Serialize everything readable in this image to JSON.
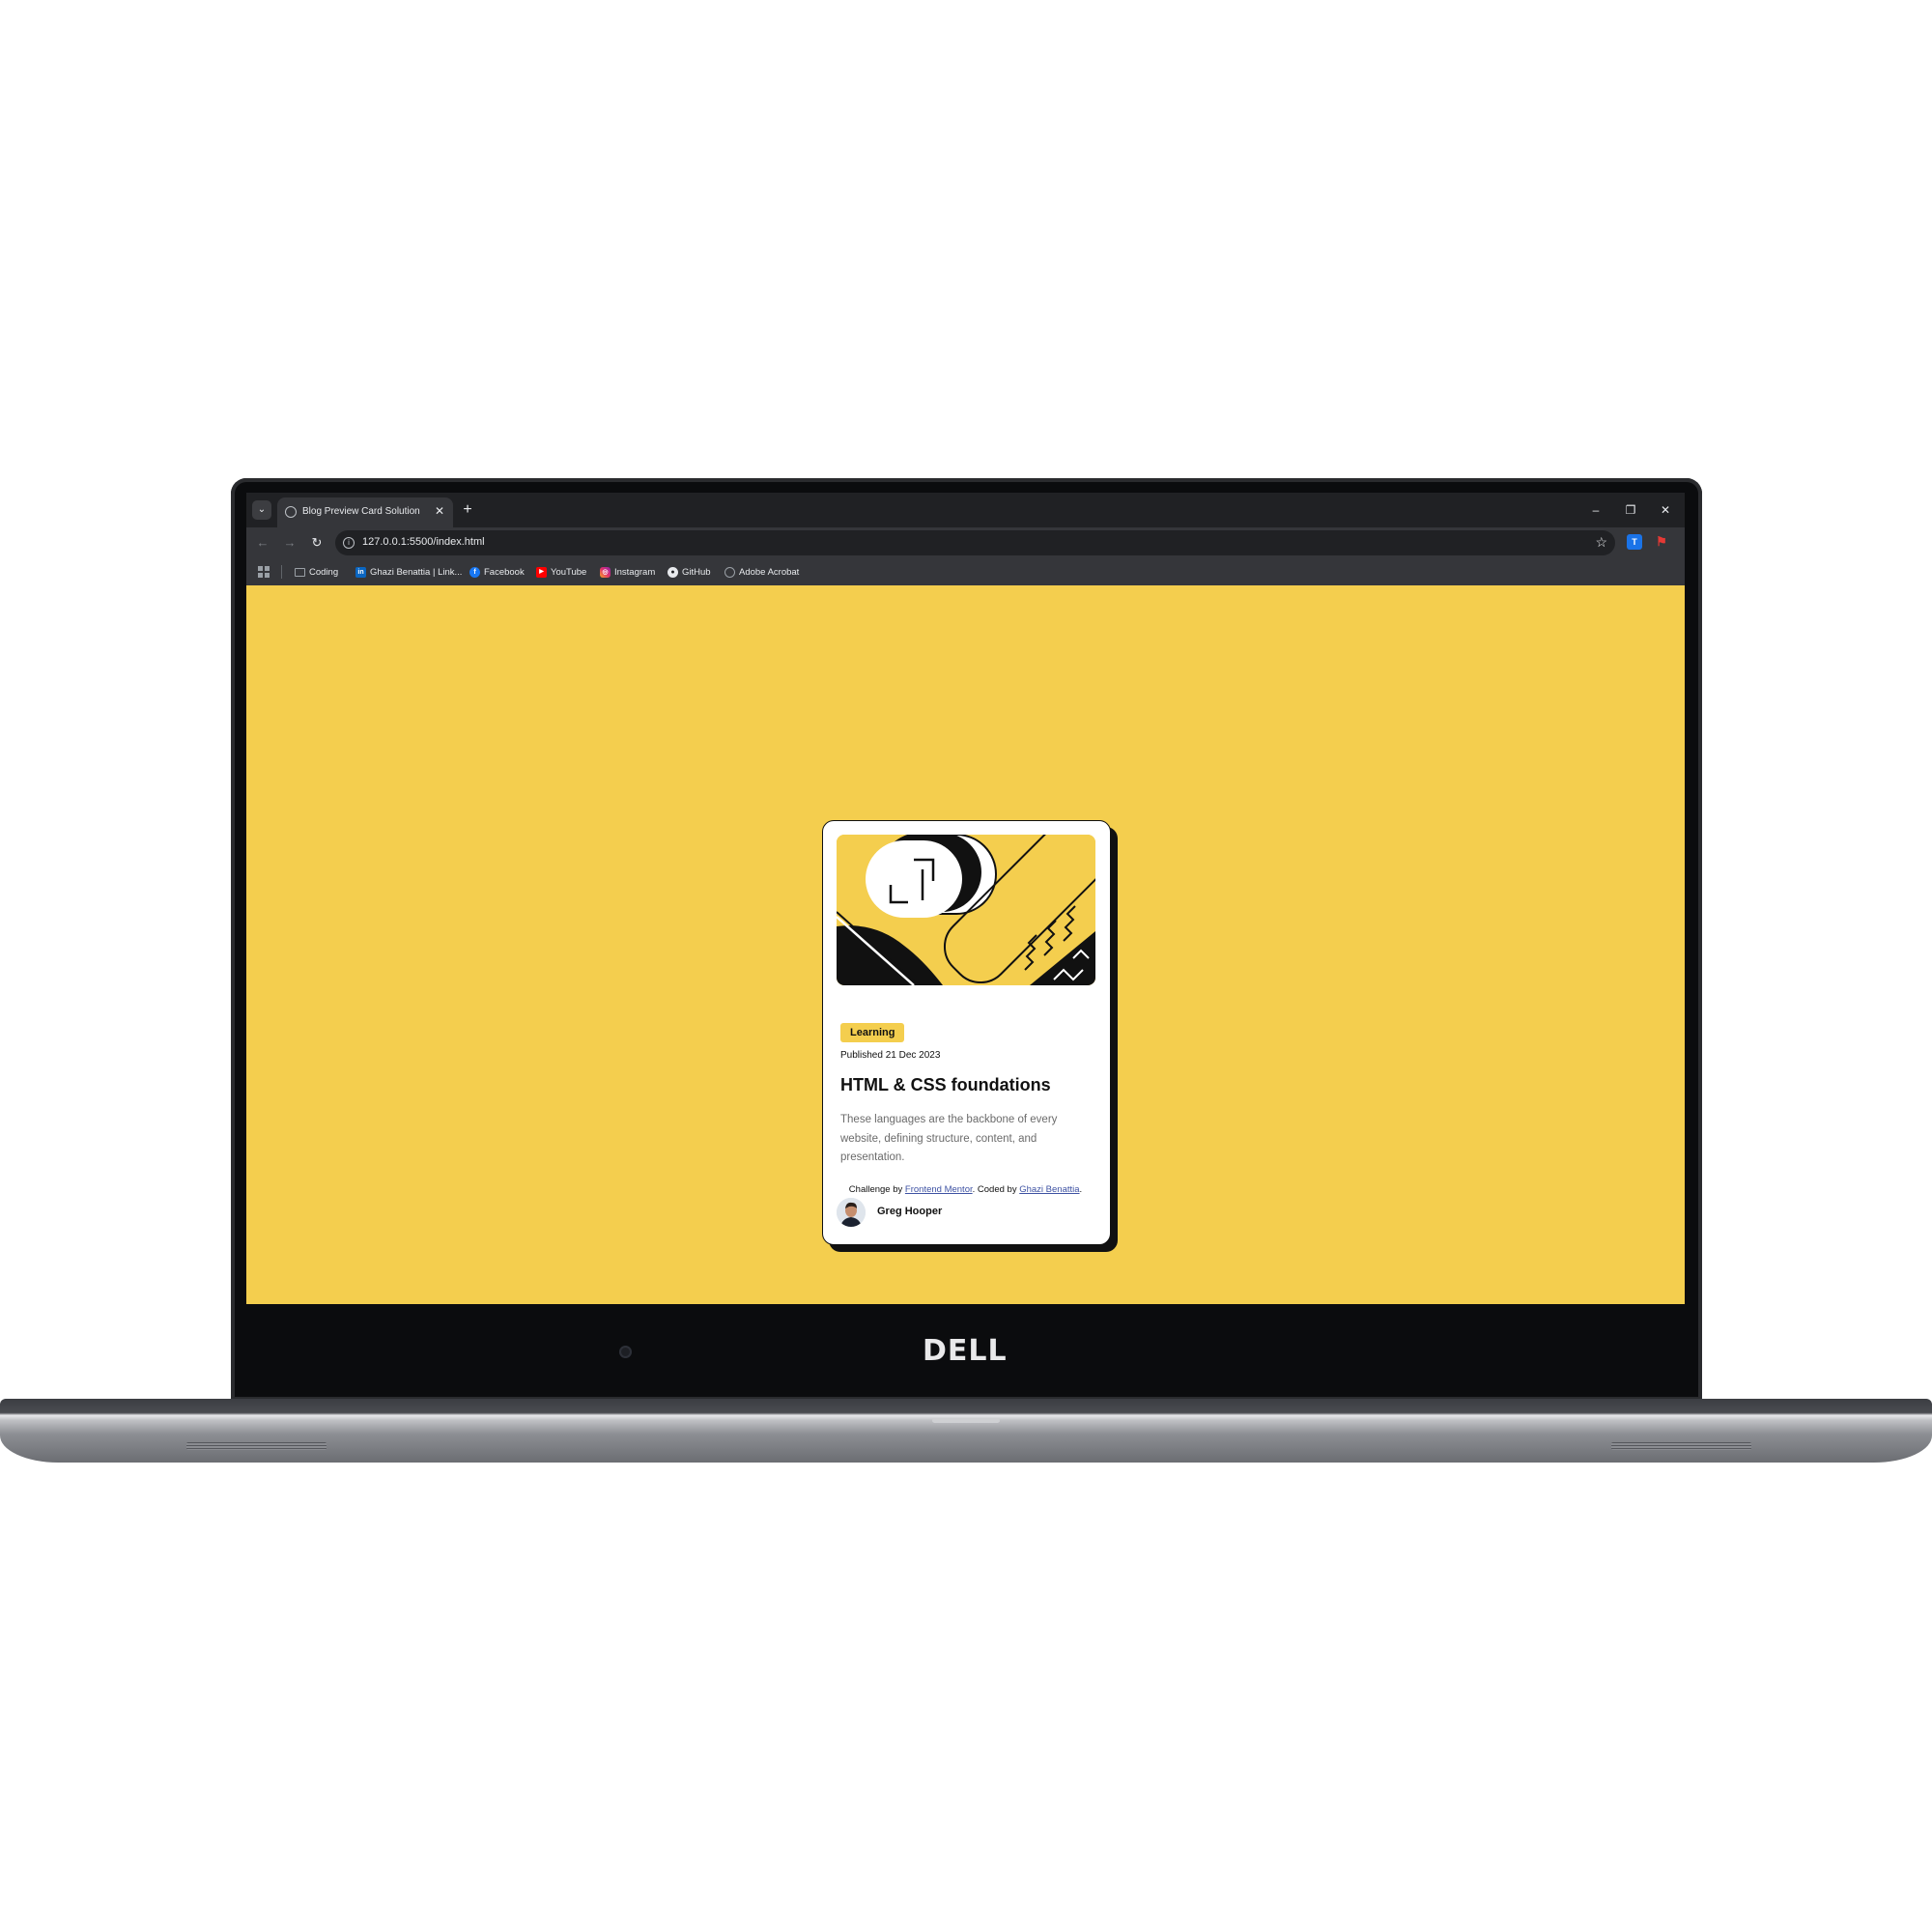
{
  "browser": {
    "tab_title": "Blog Preview Card Solution",
    "tab_close": "✕",
    "new_tab": "+",
    "window_minimize": "–",
    "window_restore": "❐",
    "window_close": "✕",
    "url": "127.0.0.1:5500/index.html",
    "bookmarks": [
      {
        "label": "Coding",
        "icon": "folder-icon",
        "color": "#9aa0a6"
      },
      {
        "label": "Ghazi Benattia | Link...",
        "icon": "linkedin-icon",
        "color": "#0a66c2"
      },
      {
        "label": "Facebook",
        "icon": "facebook-icon",
        "color": "#1877f2"
      },
      {
        "label": "YouTube",
        "icon": "youtube-icon",
        "color": "#ff0000"
      },
      {
        "label": "Instagram",
        "icon": "instagram-icon",
        "color": "#e1306c"
      },
      {
        "label": "GitHub",
        "icon": "github-icon",
        "color": "#e8eaed"
      },
      {
        "label": "Adobe Acrobat",
        "icon": "globe-icon",
        "color": "#9aa0a6"
      }
    ]
  },
  "card": {
    "tag": "Learning",
    "date": "Published 21 Dec 2023",
    "title": "HTML & CSS foundations",
    "description": "These languages are the backbone of every website, defining structure, content, and presentation.",
    "author": "Greg Hooper"
  },
  "attribution": {
    "prefix": "Challenge by ",
    "link1": "Frontend Mentor",
    "middle": ". Coded by ",
    "link2": "Ghazi Benattia",
    "suffix": "."
  },
  "device": {
    "brand": "DELL"
  },
  "colors": {
    "page_background": "#f4ce4e",
    "card_background": "#ffffff",
    "ink": "#111111",
    "chrome_dark": "#202124",
    "chrome_toolbar": "#35363a"
  }
}
